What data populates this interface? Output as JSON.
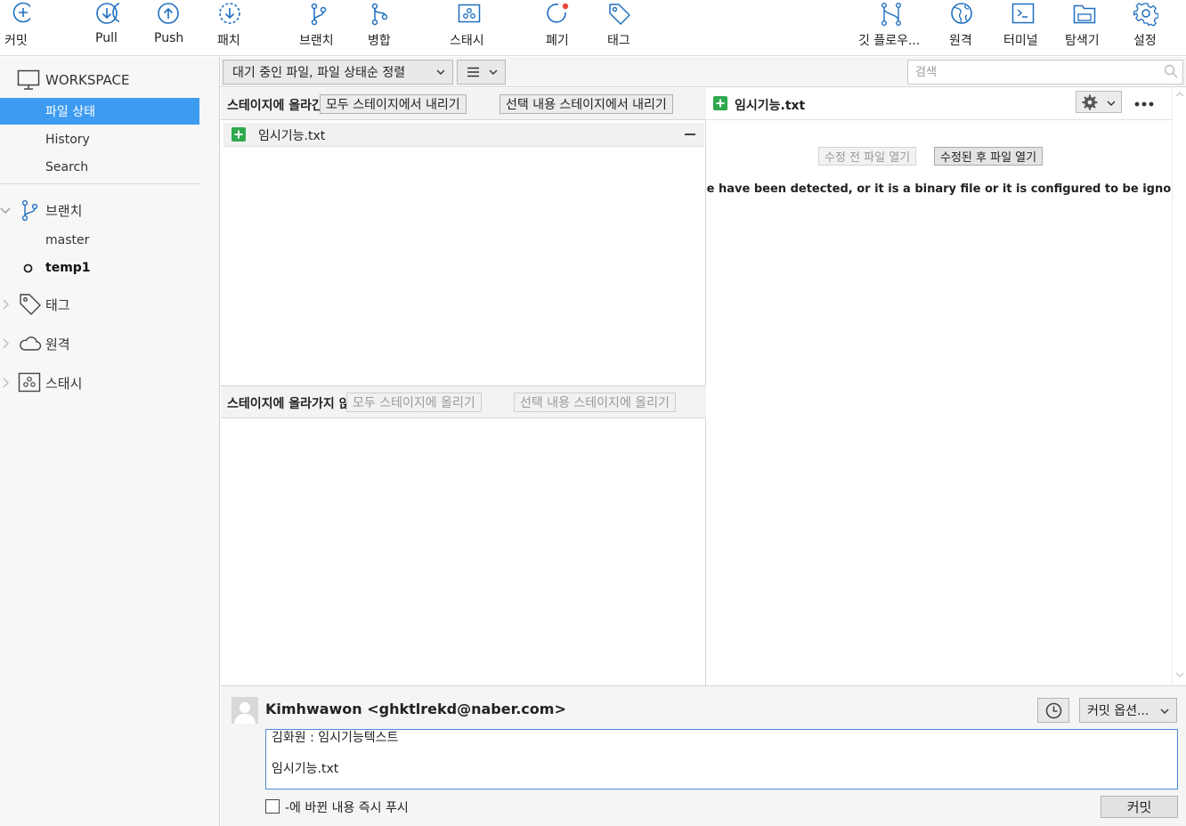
{
  "toolbar": {
    "commit": "커밋",
    "pull": "Pull",
    "push": "Push",
    "fetch": "패치",
    "branch": "브랜치",
    "merge": "병합",
    "stash": "스태시",
    "discard": "폐기",
    "tag": "태그",
    "git_flow": "깃 플로우...",
    "remote": "원격",
    "terminal": "터미널",
    "explorer": "탐색기",
    "settings": "설정"
  },
  "sidebar": {
    "workspace": "WORKSPACE",
    "workspace_items": [
      "파일 상태",
      "History",
      "Search"
    ],
    "branches_title": "브랜치",
    "branches": [
      "master",
      "temp1"
    ],
    "current_branch": "temp1",
    "tags_title": "태그",
    "remotes_title": "원격",
    "stashes_title": "스태시"
  },
  "filter": {
    "sort_label": "대기 중인 파일, 파일 상태순 정렬",
    "view_icon": "list-icon",
    "search_placeholder": "검색"
  },
  "staged": {
    "title": "스테이지에 올라간 파일",
    "unstage_all": "모두 스테이지에서 내리기",
    "unstage_selected": "선택 내용 스테이지에서 내리기",
    "files": [
      "임시기능.txt"
    ]
  },
  "unstaged": {
    "title": "스테이지에 올라가지 않은 파일",
    "stage_all": "모두 스테이지에 올리기",
    "stage_selected": "선택 내용 스테이지에 올리기"
  },
  "diff": {
    "file": "임시기능.txt",
    "open_before": "수정 전 파일 열기",
    "open_after": "수정된 후 파일 열기",
    "message": "No changes to this file have been detected, or it is a binary file or it is configured to be ignored by"
  },
  "commit": {
    "author": "Kimhwawon <ghktlrekd@naber.com>",
    "message_line1": "김화원 : 임시기능텍스트",
    "message_line2": "임시기능.txt",
    "options": "커밋 옵션...",
    "push_label": "-에 바뀐 내용 즉시 푸시",
    "push_checked": false,
    "commit_button": "커밋"
  },
  "colors": {
    "accent": "#3d9bf0",
    "icon_blue": "#1f6fbf",
    "staged_green": "#2fa94e",
    "discard_red": "#e8453c"
  }
}
